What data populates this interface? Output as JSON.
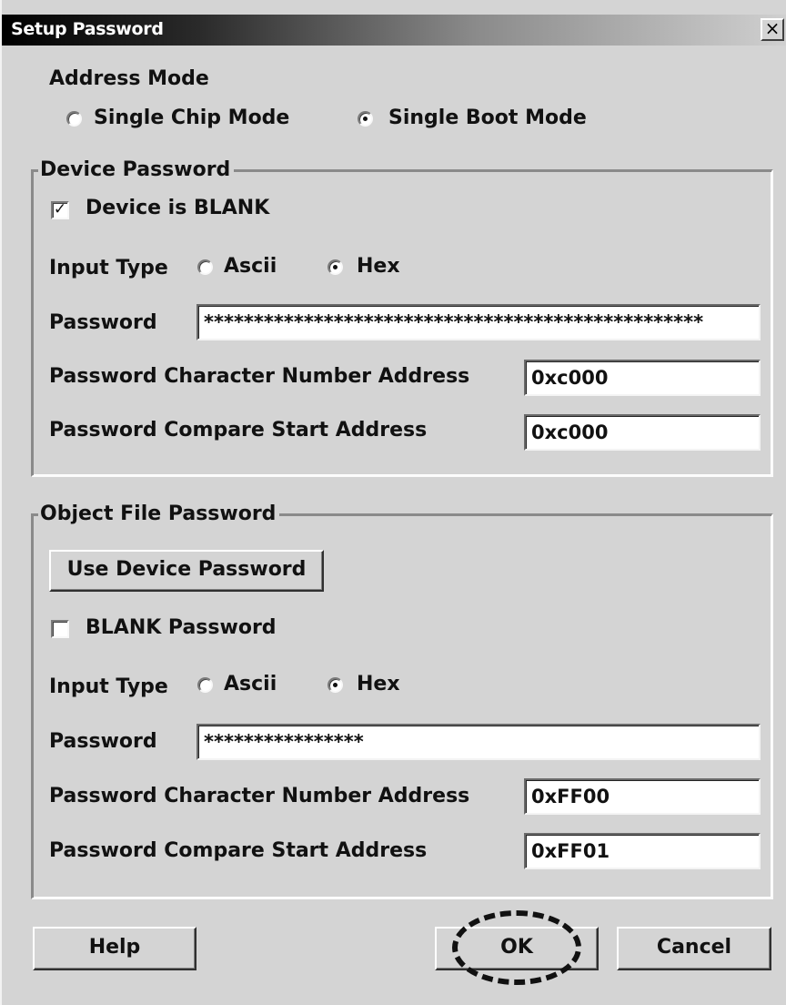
{
  "window": {
    "title": "Setup Password",
    "close_glyph": "×"
  },
  "address_mode": {
    "label": "Address Mode",
    "options": [
      {
        "label": "Single Chip Mode",
        "selected": false
      },
      {
        "label": "Single Boot Mode",
        "selected": true
      }
    ]
  },
  "device_password": {
    "legend": "Device Password",
    "blank_checkbox": {
      "label": "Device is BLANK",
      "checked": true,
      "glyph": "✓"
    },
    "input_type": {
      "label": "Input Type",
      "options": [
        {
          "label": "Ascii",
          "selected": false
        },
        {
          "label": "Hex",
          "selected": true
        }
      ]
    },
    "password": {
      "label": "Password",
      "value": "**************************************************"
    },
    "char_number_address": {
      "label": "Password Character Number Address",
      "value": "0xc000"
    },
    "compare_start_address": {
      "label": "Password Compare Start Address",
      "value": "0xc000"
    }
  },
  "object_file_password": {
    "legend": "Object File Password",
    "use_device_button": "Use Device Password",
    "blank_checkbox": {
      "label": "BLANK Password",
      "checked": false
    },
    "input_type": {
      "label": "Input Type",
      "options": [
        {
          "label": "Ascii",
          "selected": false
        },
        {
          "label": "Hex",
          "selected": true
        }
      ]
    },
    "password": {
      "label": "Password",
      "value": "****************"
    },
    "char_number_address": {
      "label": "Password Character Number Address",
      "value": "0xFF00"
    },
    "compare_start_address": {
      "label": "Password Compare Start Address",
      "value": "0xFF01"
    }
  },
  "buttons": {
    "help": "Help",
    "ok": "OK",
    "cancel": "Cancel"
  }
}
